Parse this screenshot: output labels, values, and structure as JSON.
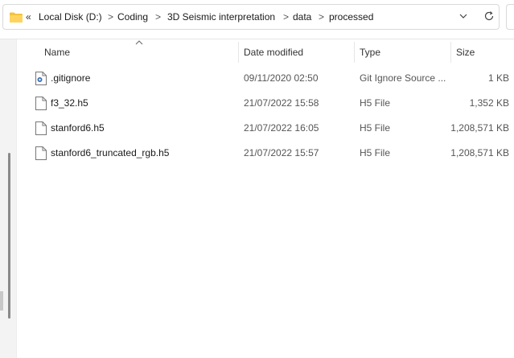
{
  "address_bar": {
    "overflow_label": "«",
    "breadcrumbs": [
      "Local Disk (D:)",
      "Coding",
      "3D Seismic interpretation",
      "data",
      "processed"
    ],
    "separator": ">"
  },
  "columns": {
    "name": "Name",
    "date_modified": "Date modified",
    "type": "Type",
    "size": "Size"
  },
  "files": [
    {
      "name": ".gitignore",
      "date_modified": "09/11/2020 02:50",
      "type": "Git Ignore Source ...",
      "size": "1 KB",
      "icon": "settings-file-icon"
    },
    {
      "name": "f3_32.h5",
      "date_modified": "21/07/2022 15:58",
      "type": "H5 File",
      "size": "1,352 KB",
      "icon": "file-icon"
    },
    {
      "name": "stanford6.h5",
      "date_modified": "21/07/2022 16:05",
      "type": "H5 File",
      "size": "1,208,571 KB",
      "icon": "file-icon"
    },
    {
      "name": "stanford6_truncated_rgb.h5",
      "date_modified": "21/07/2022 15:57",
      "type": "H5 File",
      "size": "1,208,571 KB",
      "icon": "file-icon"
    }
  ],
  "colors": {
    "folder": "#f4c241",
    "border": "#d9d9d9",
    "text": "#1a1a1a",
    "muted": "#555555"
  }
}
